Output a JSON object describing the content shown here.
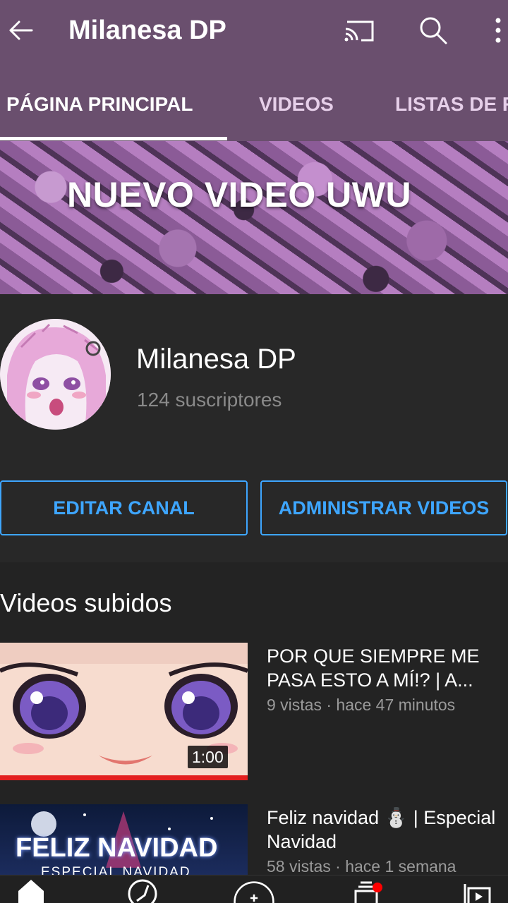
{
  "topbar": {
    "title": "Milanesa DP",
    "back_icon": "arrow-left-icon",
    "cast_icon": "cast-icon",
    "search_icon": "search-icon",
    "more_icon": "more-vert-icon"
  },
  "tabs": [
    {
      "label": "PÁGINA PRINCIPAL",
      "active": true
    },
    {
      "label": "VIDEOS",
      "active": false
    },
    {
      "label": "LISTAS DE R",
      "active": false
    }
  ],
  "banner": {
    "text": "NUEVO VIDEO UWU"
  },
  "channel": {
    "name": "Milanesa DP",
    "subscribers": "124 suscriptores"
  },
  "actions": {
    "edit_label": "EDITAR CANAL",
    "manage_label": "ADMINISTRAR VIDEOS"
  },
  "uploads": {
    "title": "Videos subidos",
    "videos": [
      {
        "title": "POR QUE SIEMPRE ME PASA ESTO A MÍ!? | A...",
        "meta": "9 vistas · hace 47 minutos",
        "duration": "1:00",
        "watched_fraction": 1.0
      },
      {
        "title": "Feliz navidad ⛄ | Especial Navidad",
        "meta": "58 vistas · hace 1 semana",
        "thumb_text": "FELIZ NAVIDAD",
        "thumb_subtext": "ESPECIAL NAVIDAD"
      }
    ]
  },
  "bottom_nav": {
    "items": [
      "home-icon",
      "explore-icon",
      "add-icon",
      "subscriptions-icon",
      "library-icon"
    ],
    "subscriptions_has_notification": true
  },
  "colors": {
    "appbar": "#6a4f6e",
    "background": "#282828",
    "accent_blue": "#3ea6ff",
    "progress_red": "#e31f1f"
  }
}
